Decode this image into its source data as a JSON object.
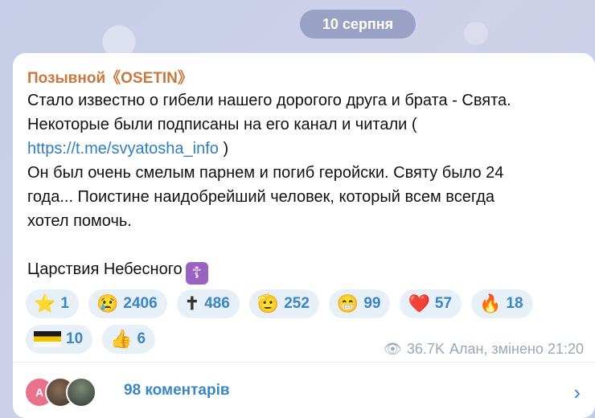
{
  "date_label": "10 серпня",
  "post": {
    "sender": "Позывной《OSETIN》",
    "lines": [
      "Стало известно о гибели нашего дорогого друга и брата - Свята.",
      "Некоторые были подписаны на его канал и читали (",
      "Он был очень смелым парнем и погиб геройски. Святу было 24",
      "года... Поистине наидобрейший человек, который всем всегда",
      "хотел помочь.",
      "Царствия Небесного"
    ],
    "link": "https://t.me/svyatosha_info",
    "link_suffix": " )",
    "cross_emoji": "☦"
  },
  "reactions": [
    {
      "emoji": "⭐",
      "count": "1"
    },
    {
      "emoji": "😢",
      "count": "2406"
    },
    {
      "emoji": "✝",
      "count": "486"
    },
    {
      "emoji": "🫡",
      "count": "252"
    },
    {
      "emoji": "😁",
      "count": "99"
    },
    {
      "emoji": "❤️",
      "count": "57"
    },
    {
      "emoji": "🔥",
      "count": "18"
    },
    {
      "emoji": "flag",
      "count": "10"
    },
    {
      "emoji": "👍",
      "count": "6"
    }
  ],
  "meta": {
    "views": "36.7K",
    "author_time": "Алан, змінено 21:20"
  },
  "comments": {
    "avatar_letter": "А",
    "label": "98 коментарів",
    "chevron": "›"
  }
}
